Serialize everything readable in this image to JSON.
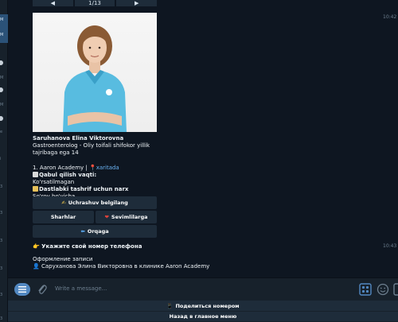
{
  "left_strip": {
    "labels": [
      {
        "text": "M"
      },
      {
        "text": "M"
      },
      {
        "text": "M"
      },
      {
        "text": "M"
      },
      {
        "text": "e"
      },
      {
        "text": "i"
      },
      {
        "text": "3"
      },
      {
        "text": "3"
      },
      {
        "text": "3"
      },
      {
        "text": "3"
      },
      {
        "text": "3"
      },
      {
        "text": "3"
      }
    ]
  },
  "pager": {
    "prev": "◀",
    "page": "1/13",
    "next": "▶"
  },
  "doctor_card": {
    "name": "Saruhanova Elina Viktorovna",
    "specialty": "Gastroenterolog - Oliy toifali shifokor yillik tajribaga ega 14",
    "clinic": "1. Aaron Academy |",
    "map_link": "xaritada",
    "slots_label": "Qabul qilish vaqti:",
    "slots_value": "Ko'rsatilmagan",
    "price_label": "Dastlabki tashrif uchun narx",
    "price_value": "So'rov bo'yicha",
    "time": "10:42"
  },
  "inline_keyboard": {
    "book": "Uchrashuv belgilang",
    "reviews": "Sharhlar",
    "favorites": "Sevimlilarga",
    "back": "Orqaga"
  },
  "phone_prompt": {
    "text": "Укажите свой номер телефона",
    "time": "10:43"
  },
  "booking_msg": {
    "title": "Оформление записи",
    "detail": "Саруханова Элина Викторовна в клинике Aaron Academy"
  },
  "input": {
    "placeholder": "Write a message..."
  },
  "reply_keyboard": {
    "share_phone": "Поделиться номером",
    "main_menu": "Назад в главное меню"
  },
  "colors": {
    "background": "#0e1621",
    "panel": "#17212b",
    "button": "#1e2c3a",
    "accent": "#5288c1",
    "link": "#6ab2f2"
  }
}
